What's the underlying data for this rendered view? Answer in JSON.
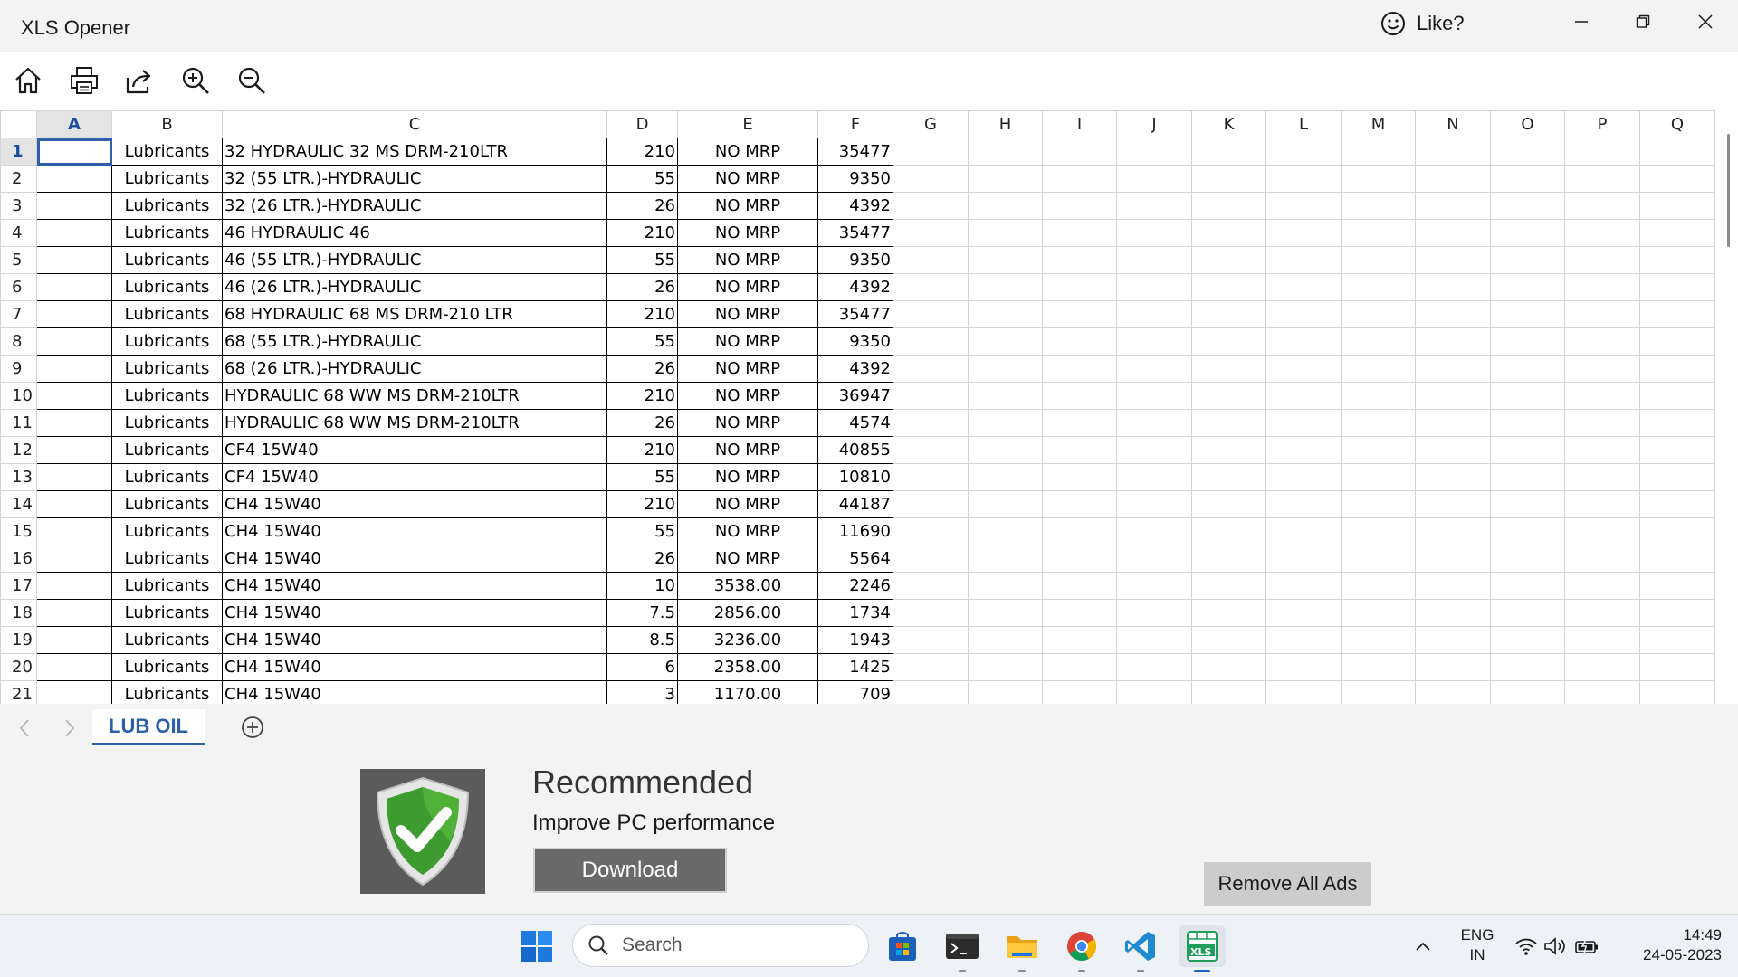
{
  "window": {
    "title": "XLS Opener",
    "like_label": "Like?"
  },
  "toolbar": {
    "icons": [
      "home-icon",
      "print-icon",
      "share-icon",
      "zoom-in-icon",
      "zoom-out-icon"
    ]
  },
  "sheet": {
    "columns": [
      "A",
      "B",
      "C",
      "D",
      "E",
      "F",
      "G",
      "H",
      "I",
      "J",
      "K",
      "L",
      "M",
      "N",
      "O",
      "P",
      "Q"
    ],
    "active_column": "A",
    "active_row": 1,
    "rows": [
      {
        "n": "1",
        "b": "Lubricants",
        "c": "32 HYDRAULIC 32 MS DRM-210LTR",
        "d": "210",
        "e": "NO MRP",
        "f": "35477"
      },
      {
        "n": "2",
        "b": "Lubricants",
        "c": "32 (55 LTR.)-HYDRAULIC",
        "d": "55",
        "e": "NO MRP",
        "f": "9350"
      },
      {
        "n": "3",
        "b": "Lubricants",
        "c": "32 (26 LTR.)-HYDRAULIC",
        "d": "26",
        "e": "NO MRP",
        "f": "4392"
      },
      {
        "n": "4",
        "b": "Lubricants",
        "c": "46 HYDRAULIC 46",
        "d": "210",
        "e": "NO MRP",
        "f": "35477"
      },
      {
        "n": "5",
        "b": "Lubricants",
        "c": "46 (55 LTR.)-HYDRAULIC",
        "d": "55",
        "e": "NO MRP",
        "f": "9350"
      },
      {
        "n": "6",
        "b": "Lubricants",
        "c": "46 (26 LTR.)-HYDRAULIC",
        "d": "26",
        "e": "NO MRP",
        "f": "4392"
      },
      {
        "n": "7",
        "b": "Lubricants",
        "c": "68 HYDRAULIC 68 MS DRM-210 LTR",
        "d": "210",
        "e": "NO MRP",
        "f": "35477"
      },
      {
        "n": "8",
        "b": "Lubricants",
        "c": "68 (55 LTR.)-HYDRAULIC",
        "d": "55",
        "e": "NO MRP",
        "f": "9350"
      },
      {
        "n": "9",
        "b": "Lubricants",
        "c": "68 (26 LTR.)-HYDRAULIC",
        "d": "26",
        "e": "NO MRP",
        "f": "4392"
      },
      {
        "n": "10",
        "b": "Lubricants",
        "c": "HYDRAULIC 68 WW MS DRM-210LTR",
        "d": "210",
        "e": "NO MRP",
        "f": "36947"
      },
      {
        "n": "11",
        "b": "Lubricants",
        "c": "HYDRAULIC 68 WW MS DRM-210LTR",
        "d": "26",
        "e": "NO MRP",
        "f": "4574"
      },
      {
        "n": "12",
        "b": "Lubricants",
        "c": "CF4 15W40",
        "d": "210",
        "e": "NO MRP",
        "f": "40855"
      },
      {
        "n": "13",
        "b": "Lubricants",
        "c": "CF4 15W40",
        "d": "55",
        "e": "NO MRP",
        "f": "10810"
      },
      {
        "n": "14",
        "b": "Lubricants",
        "c": "CH4 15W40",
        "d": "210",
        "e": "NO MRP",
        "f": "44187"
      },
      {
        "n": "15",
        "b": "Lubricants",
        "c": "CH4 15W40",
        "d": "55",
        "e": "NO MRP",
        "f": "11690"
      },
      {
        "n": "16",
        "b": "Lubricants",
        "c": "CH4 15W40",
        "d": "26",
        "e": "NO MRP",
        "f": "5564"
      },
      {
        "n": "17",
        "b": "Lubricants",
        "c": "CH4 15W40",
        "d": "10",
        "e": "3538.00",
        "f": "2246"
      },
      {
        "n": "18",
        "b": "Lubricants",
        "c": "CH4 15W40",
        "d": "7.5",
        "e": "2856.00",
        "f": "1734"
      },
      {
        "n": "19",
        "b": "Lubricants",
        "c": "CH4 15W40",
        "d": "8.5",
        "e": "3236.00",
        "f": "1943"
      },
      {
        "n": "20",
        "b": "Lubricants",
        "c": "CH4 15W40",
        "d": "6",
        "e": "2358.00",
        "f": "1425"
      },
      {
        "n": "21",
        "b": "Lubricants",
        "c": "CH4 15W40",
        "d": "3",
        "e": "1170.00",
        "f": "709"
      }
    ]
  },
  "tabs": {
    "sheets": [
      "LUB OIL"
    ],
    "active": "LUB OIL"
  },
  "ad": {
    "title": "Recommended",
    "subtitle": "Improve PC performance",
    "button": "Download",
    "remove_ads": "Remove All Ads"
  },
  "taskbar": {
    "search_placeholder": "Search",
    "lang_line1": "ENG",
    "lang_line2": "IN",
    "time": "14:49",
    "date": "24-05-2023",
    "app_label": "XLS"
  },
  "colors": {
    "accent": "#2e5fa8",
    "titlebar_bg": "#f3f3f3",
    "ad_button": "#6a6a6a",
    "shield_green": "#3d9b2f"
  }
}
